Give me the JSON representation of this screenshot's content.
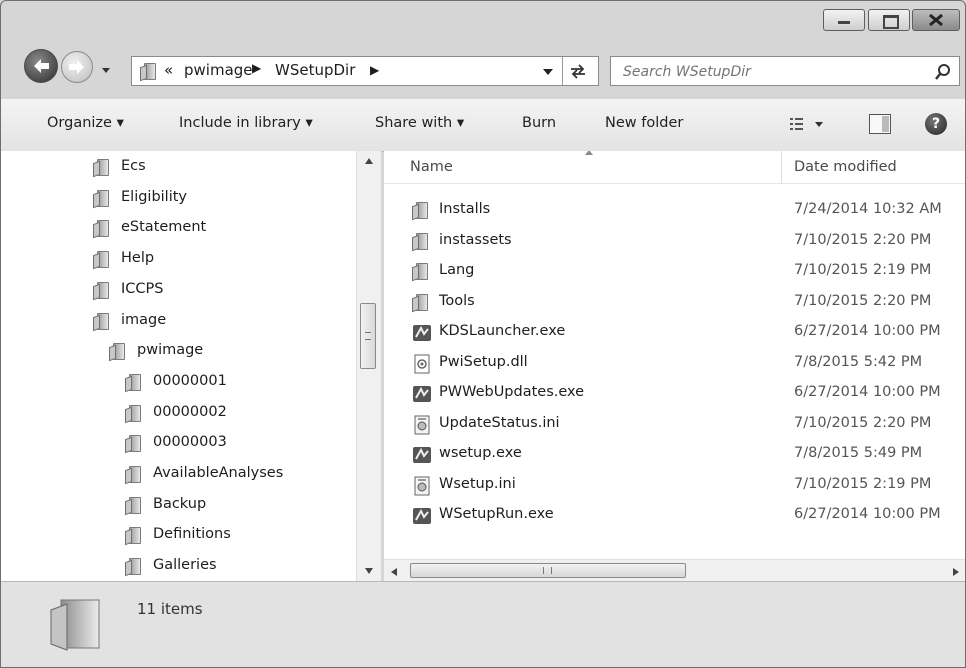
{
  "window": {
    "caption_buttons": [
      "minimize",
      "maximize",
      "close"
    ]
  },
  "address_bar": {
    "overflow_glyph": "«",
    "crumbs": [
      "pwimage",
      "WSetupDir"
    ],
    "search_placeholder": "Search WSetupDir"
  },
  "toolbar": {
    "organize": "Organize",
    "include_in_library": "Include in library",
    "share_with": "Share with",
    "burn": "Burn",
    "new_folder": "New folder"
  },
  "nav_tree": [
    {
      "label": "Ecs",
      "level": 1
    },
    {
      "label": "Eligibility",
      "level": 1
    },
    {
      "label": "eStatement",
      "level": 1
    },
    {
      "label": "Help",
      "level": 1
    },
    {
      "label": "ICCPS",
      "level": 1
    },
    {
      "label": "image",
      "level": 1
    },
    {
      "label": "pwimage",
      "level": 2
    },
    {
      "label": "00000001",
      "level": 3
    },
    {
      "label": "00000002",
      "level": 3
    },
    {
      "label": "00000003",
      "level": 3
    },
    {
      "label": "AvailableAnalyses",
      "level": 3
    },
    {
      "label": "Backup",
      "level": 3
    },
    {
      "label": "Definitions",
      "level": 3
    },
    {
      "label": "Galleries",
      "level": 3
    }
  ],
  "columns": {
    "name": "Name",
    "date_modified": "Date modified"
  },
  "files": [
    {
      "name": "Installs",
      "date": "7/24/2014 10:32 AM",
      "icon": "folder-icon"
    },
    {
      "name": "instassets",
      "date": "7/10/2015 2:20 PM",
      "icon": "folder-icon"
    },
    {
      "name": "Lang",
      "date": "7/10/2015 2:19 PM",
      "icon": "folder-icon"
    },
    {
      "name": "Tools",
      "date": "7/10/2015 2:20 PM",
      "icon": "folder-icon"
    },
    {
      "name": "KDSLauncher.exe",
      "date": "6/27/2014 10:00 PM",
      "icon": "exe-icon"
    },
    {
      "name": "PwiSetup.dll",
      "date": "7/8/2015 5:42 PM",
      "icon": "dll-icon"
    },
    {
      "name": "PWWebUpdates.exe",
      "date": "6/27/2014 10:00 PM",
      "icon": "exe-icon"
    },
    {
      "name": "UpdateStatus.ini",
      "date": "7/10/2015 2:20 PM",
      "icon": "ini-icon"
    },
    {
      "name": "wsetup.exe",
      "date": "7/8/2015 5:49 PM",
      "icon": "exe-icon"
    },
    {
      "name": "Wsetup.ini",
      "date": "7/10/2015 2:19 PM",
      "icon": "ini-icon"
    },
    {
      "name": "WSetupRun.exe",
      "date": "6/27/2014 10:00 PM",
      "icon": "exe-icon"
    }
  ],
  "status": {
    "item_count": "11 items"
  }
}
